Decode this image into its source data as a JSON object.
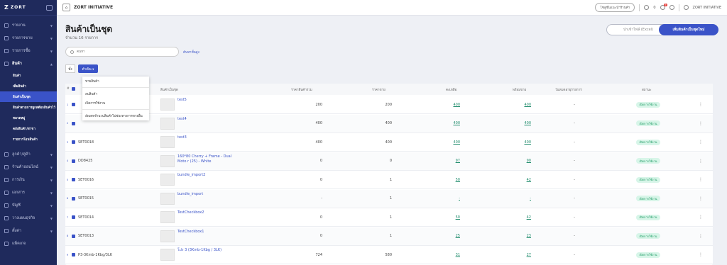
{
  "sidebar": {
    "logo_text": "ZORT",
    "items": [
      {
        "label": "รายงาน"
      },
      {
        "label": "รายการขาย"
      },
      {
        "label": "รายการซื้อ"
      },
      {
        "label": "สินค้า"
      },
      {
        "label": "ลูกค้า/คู่ค้า"
      },
      {
        "label": "ร้านค้าออนไลน์"
      },
      {
        "label": "การเงิน"
      },
      {
        "label": "เอกสาร"
      },
      {
        "label": "บัญชี"
      },
      {
        "label": "วางแผนธุรกิจ"
      },
      {
        "label": "ตั้งค่า"
      },
      {
        "label": "แพ็คเกจ"
      }
    ],
    "sub_items": [
      {
        "label": "สินค้า"
      },
      {
        "label": "เพิ่มสินค้า"
      },
      {
        "label": "สินค้าเป็นชุด"
      },
      {
        "label": "สินค้าตามการผูกสต๊อกสินค้าไว้"
      },
      {
        "label": "หมวดหมู่"
      },
      {
        "label": "คลังสินค้า/สาขา"
      },
      {
        "label": "รายการโอนสินค้า"
      }
    ]
  },
  "topbar": {
    "company": "ZORT INITIATIVE",
    "help_pill": "โซลูชั่นแนะนำร้านค้า",
    "credit": "0",
    "notify_badge": "9",
    "user": "ZORT INITIATIVE"
  },
  "page": {
    "title": "สินค้าเป็นชุด",
    "count": "จำนวน 16 รายการ",
    "import_label": "นำเข้าไฟล์ (Excel)",
    "add_label": "เพิ่มสินค้าเป็นชุดใหม่",
    "search_placeholder": "ค้นหา",
    "advanced_search": "ค้นหาขั้นสูง",
    "all_button": "ทั้ง",
    "action_button": "ดำเนิน ▾"
  },
  "menu": {
    "items": [
      "ขายสินค้า",
      "ลบสินค้า",
      "เปิดการใช้งาน",
      "อัพเดทจำนวนสินค้าไปช่องทางการขายอื่น"
    ]
  },
  "table": {
    "headers": {
      "sku": "#",
      "name": "สินค้าเป็นชุด",
      "cost": "ราคาสินค้ารวม",
      "price": "ราคาขาย",
      "stock": "คงเหลือ",
      "avail": "พร้อมขาย",
      "date": "วันหมดอายุรายการ",
      "status": "สถานะ"
    },
    "rows": [
      {
        "num": "1",
        "sku": "",
        "name": "test5",
        "cost": "200",
        "price": "200",
        "stock": "400",
        "avail": "400",
        "date": "-",
        "status": "เปิดการใช้งาน"
      },
      {
        "num": "2",
        "sku": "",
        "name": "test4",
        "cost": "400",
        "price": "400",
        "stock": "400",
        "avail": "400",
        "date": "-",
        "status": "เปิดการใช้งาน"
      },
      {
        "num": "3",
        "sku": "SET0018",
        "name": "test3",
        "cost": "400",
        "price": "400",
        "stock": "400",
        "avail": "400",
        "date": "-",
        "status": "เปิดการใช้งาน"
      },
      {
        "num": "4",
        "sku": "DD8425",
        "name": "160*80 Cherry + Frame - Dual Moto r (25) - White",
        "cost": "0",
        "price": "0",
        "stock": "97",
        "avail": "90",
        "date": "-",
        "status": "เปิดการใช้งาน"
      },
      {
        "num": "5",
        "sku": "SET0016",
        "name": "bundle_import2",
        "cost": "0",
        "price": "1",
        "stock": "50",
        "avail": "42",
        "date": "-",
        "status": "เปิดการใช้งาน"
      },
      {
        "num": "6",
        "sku": "SET0015",
        "name": "bundle_import",
        "cost": "-",
        "price": "1",
        "stock": "-",
        "avail": "-",
        "date": "-",
        "status": "เปิดการใช้งาน"
      },
      {
        "num": "7",
        "sku": "SET0014",
        "name": "TestCheckbox2",
        "cost": "0",
        "price": "1",
        "stock": "50",
        "avail": "42",
        "date": "-",
        "status": "เปิดการใช้งาน"
      },
      {
        "num": "8",
        "sku": "SET0013",
        "name": "TestCheckbox1",
        "cost": "0",
        "price": "1",
        "stock": "25",
        "avail": "23",
        "date": "-",
        "status": "เปิดการใช้งาน"
      },
      {
        "num": "9",
        "sku": "P3-3Kmb-1Kbg/3LK",
        "name": "โปร 3 (3Kmb-1Kbg / 3LK)",
        "cost": "724",
        "price": "580",
        "stock": "31",
        "avail": "27",
        "date": "-",
        "status": "เปิดการใช้งาน"
      }
    ]
  }
}
